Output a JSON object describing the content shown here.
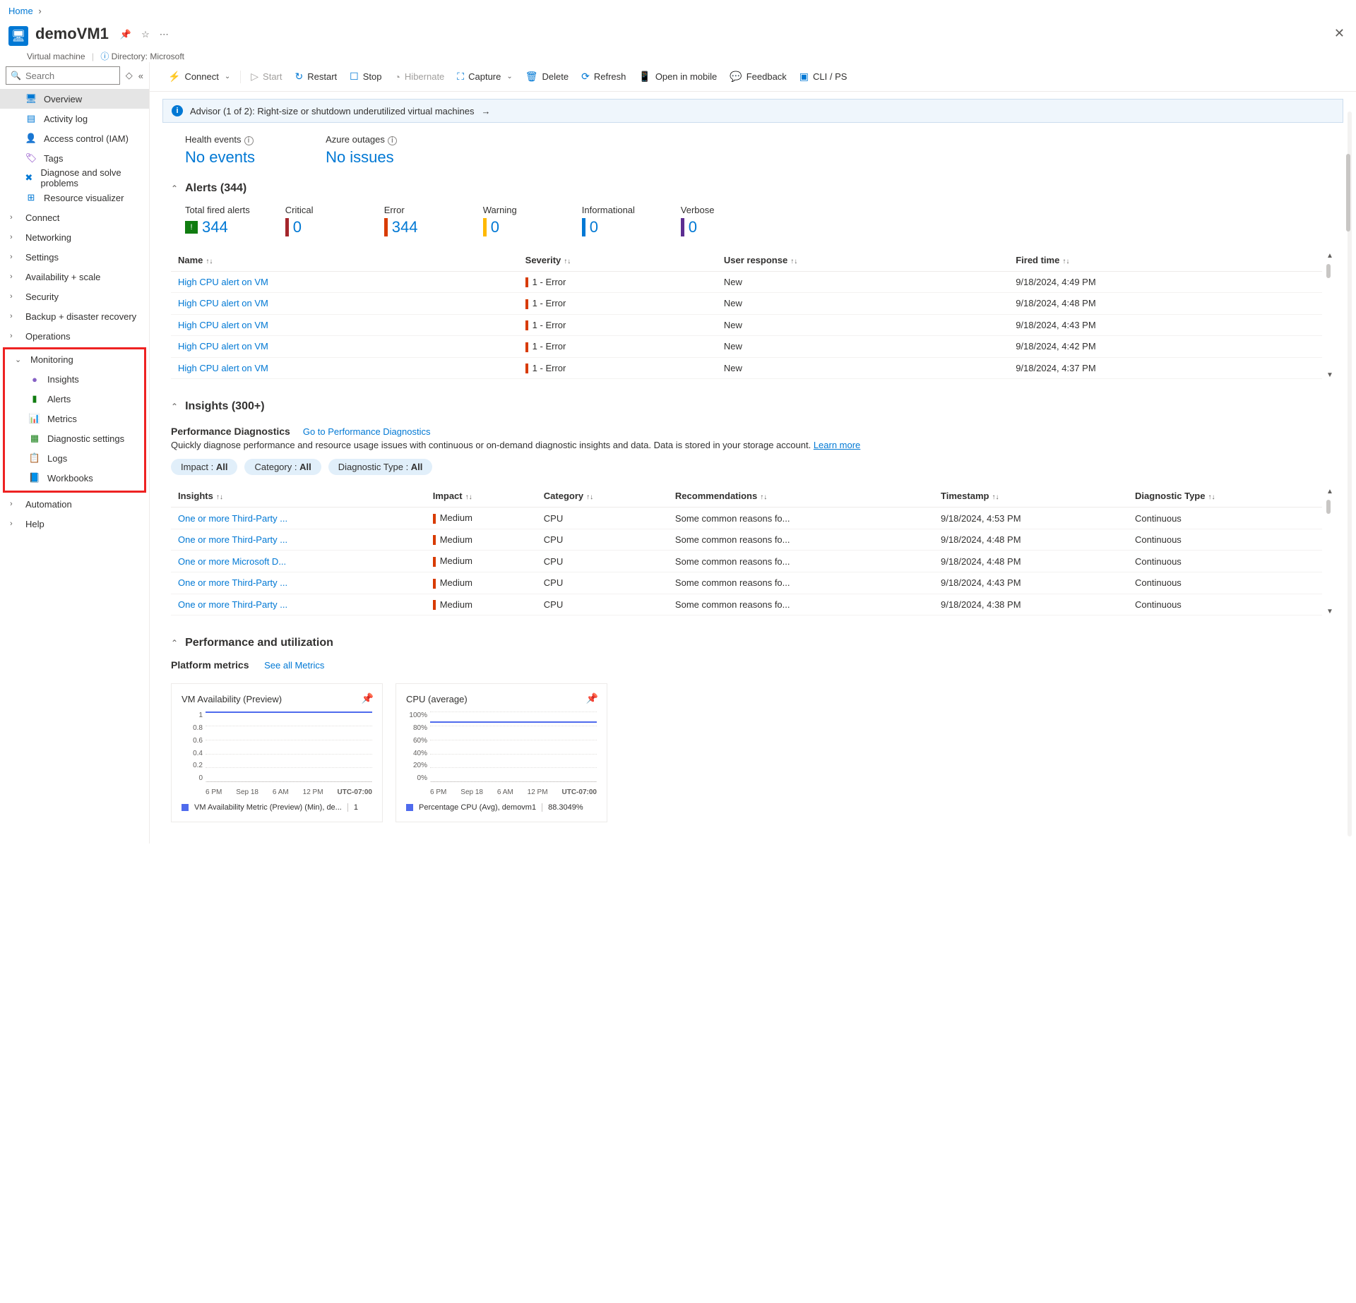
{
  "breadcrumb": {
    "home": "Home"
  },
  "header": {
    "title": "demoVM1",
    "subtitle_type": "Virtual machine",
    "subtitle_dir": "Directory: Microsoft"
  },
  "sidebar": {
    "search_placeholder": "Search",
    "items": [
      {
        "label": "Overview",
        "icon": "🖥",
        "color": "#0078d4",
        "selected": true
      },
      {
        "label": "Activity log",
        "icon": "▤",
        "color": "#0078d4"
      },
      {
        "label": "Access control (IAM)",
        "icon": "👤",
        "color": "#d83b01"
      },
      {
        "label": "Tags",
        "icon": "🏷",
        "color": "#7b2fbf"
      },
      {
        "label": "Diagnose and solve problems",
        "icon": "✖",
        "color": "#0078d4"
      },
      {
        "label": "Resource visualizer",
        "icon": "⊞",
        "color": "#0078d4"
      }
    ],
    "groups": [
      {
        "label": "Connect"
      },
      {
        "label": "Networking"
      },
      {
        "label": "Settings"
      },
      {
        "label": "Availability + scale"
      },
      {
        "label": "Security"
      },
      {
        "label": "Backup + disaster recovery"
      },
      {
        "label": "Operations"
      }
    ],
    "monitoring": {
      "label": "Monitoring",
      "items": [
        {
          "label": "Insights",
          "icon": "●",
          "color": "#8661c5"
        },
        {
          "label": "Alerts",
          "icon": "▮",
          "color": "#107c10"
        },
        {
          "label": "Metrics",
          "icon": "📊",
          "color": "#0078d4"
        },
        {
          "label": "Diagnostic settings",
          "icon": "▦",
          "color": "#107c10"
        },
        {
          "label": "Logs",
          "icon": "📋",
          "color": "#0078d4"
        },
        {
          "label": "Workbooks",
          "icon": "📘",
          "color": "#0078d4"
        }
      ]
    },
    "bottom_groups": [
      {
        "label": "Automation"
      },
      {
        "label": "Help"
      }
    ]
  },
  "toolbar": {
    "connect": "Connect",
    "start": "Start",
    "restart": "Restart",
    "stop": "Stop",
    "hibernate": "Hibernate",
    "capture": "Capture",
    "delete": "Delete",
    "refresh": "Refresh",
    "open_mobile": "Open in mobile",
    "feedback": "Feedback",
    "cli": "CLI / PS"
  },
  "advisor": "Advisor (1 of 2): Right-size or shutdown underutilized virtual machines",
  "health": {
    "events_label": "Health events",
    "events_value": "No events",
    "outages_label": "Azure outages",
    "outages_value": "No issues"
  },
  "alerts_section": {
    "title": "Alerts (344)",
    "stats": [
      {
        "label": "Total fired alerts",
        "value": "344",
        "type": "total"
      },
      {
        "label": "Critical",
        "value": "0",
        "color": "#a4262c"
      },
      {
        "label": "Error",
        "value": "344",
        "color": "#d83b01"
      },
      {
        "label": "Warning",
        "value": "0",
        "color": "#ffb900"
      },
      {
        "label": "Informational",
        "value": "0",
        "color": "#0078d4"
      },
      {
        "label": "Verbose",
        "value": "0",
        "color": "#5c2e91"
      }
    ],
    "columns": {
      "name": "Name",
      "severity": "Severity",
      "response": "User response",
      "fired": "Fired time"
    },
    "rows": [
      {
        "name": "High CPU alert on VM",
        "severity": "1 - Error",
        "response": "New",
        "fired": "9/18/2024, 4:49 PM"
      },
      {
        "name": "High CPU alert on VM",
        "severity": "1 - Error",
        "response": "New",
        "fired": "9/18/2024, 4:48 PM"
      },
      {
        "name": "High CPU alert on VM",
        "severity": "1 - Error",
        "response": "New",
        "fired": "9/18/2024, 4:43 PM"
      },
      {
        "name": "High CPU alert on VM",
        "severity": "1 - Error",
        "response": "New",
        "fired": "9/18/2024, 4:42 PM"
      },
      {
        "name": "High CPU alert on VM",
        "severity": "1 - Error",
        "response": "New",
        "fired": "9/18/2024, 4:37 PM"
      }
    ]
  },
  "insights_section": {
    "title": "Insights (300+)",
    "perf_title": "Performance Diagnostics",
    "perf_link": "Go to Performance Diagnostics",
    "perf_desc": "Quickly diagnose performance and resource usage issues with continuous or on-demand diagnostic insights and data. Data is stored in your storage account.",
    "learn_more": "Learn more",
    "pills": [
      {
        "prefix": "Impact : ",
        "value": "All"
      },
      {
        "prefix": "Category : ",
        "value": "All"
      },
      {
        "prefix": "Diagnostic Type : ",
        "value": "All"
      }
    ],
    "columns": {
      "insights": "Insights",
      "impact": "Impact",
      "category": "Category",
      "recommendations": "Recommendations",
      "timestamp": "Timestamp",
      "diag_type": "Diagnostic Type"
    },
    "rows": [
      {
        "insights": "One or more Third-Party ...",
        "impact": "Medium",
        "category": "CPU",
        "rec": "Some common reasons fo...",
        "ts": "9/18/2024, 4:53 PM",
        "type": "Continuous"
      },
      {
        "insights": "One or more Third-Party ...",
        "impact": "Medium",
        "category": "CPU",
        "rec": "Some common reasons fo...",
        "ts": "9/18/2024, 4:48 PM",
        "type": "Continuous"
      },
      {
        "insights": "One or more Microsoft D...",
        "impact": "Medium",
        "category": "CPU",
        "rec": "Some common reasons fo...",
        "ts": "9/18/2024, 4:48 PM",
        "type": "Continuous"
      },
      {
        "insights": "One or more Third-Party ...",
        "impact": "Medium",
        "category": "CPU",
        "rec": "Some common reasons fo...",
        "ts": "9/18/2024, 4:43 PM",
        "type": "Continuous"
      },
      {
        "insights": "One or more Third-Party ...",
        "impact": "Medium",
        "category": "CPU",
        "rec": "Some common reasons fo...",
        "ts": "9/18/2024, 4:38 PM",
        "type": "Continuous"
      }
    ]
  },
  "perf_util": {
    "title": "Performance and utilization",
    "platform_label": "Platform metrics",
    "see_all": "See all Metrics"
  },
  "chart_data": [
    {
      "type": "line",
      "title": "VM Availability (Preview)",
      "ylim": [
        0,
        1
      ],
      "yticks": [
        "1",
        "0.8",
        "0.6",
        "0.4",
        "0.2",
        "0"
      ],
      "xticks": [
        "6 PM",
        "Sep 18",
        "6 AM",
        "12 PM"
      ],
      "tz": "UTC-07:00",
      "series": [
        {
          "name": "VM Availability Metric (Preview) (Min), de...",
          "value": "1",
          "flat_at_pct": 0
        }
      ]
    },
    {
      "type": "line",
      "title": "CPU (average)",
      "ylim": [
        0,
        100
      ],
      "yticks": [
        "100%",
        "80%",
        "60%",
        "40%",
        "20%",
        "0%"
      ],
      "xticks": [
        "6 PM",
        "Sep 18",
        "6 AM",
        "12 PM"
      ],
      "tz": "UTC-07:00",
      "series": [
        {
          "name": "Percentage CPU (Avg), demovm1",
          "value": "88.3049%",
          "flat_at_pct": 14
        }
      ]
    }
  ]
}
